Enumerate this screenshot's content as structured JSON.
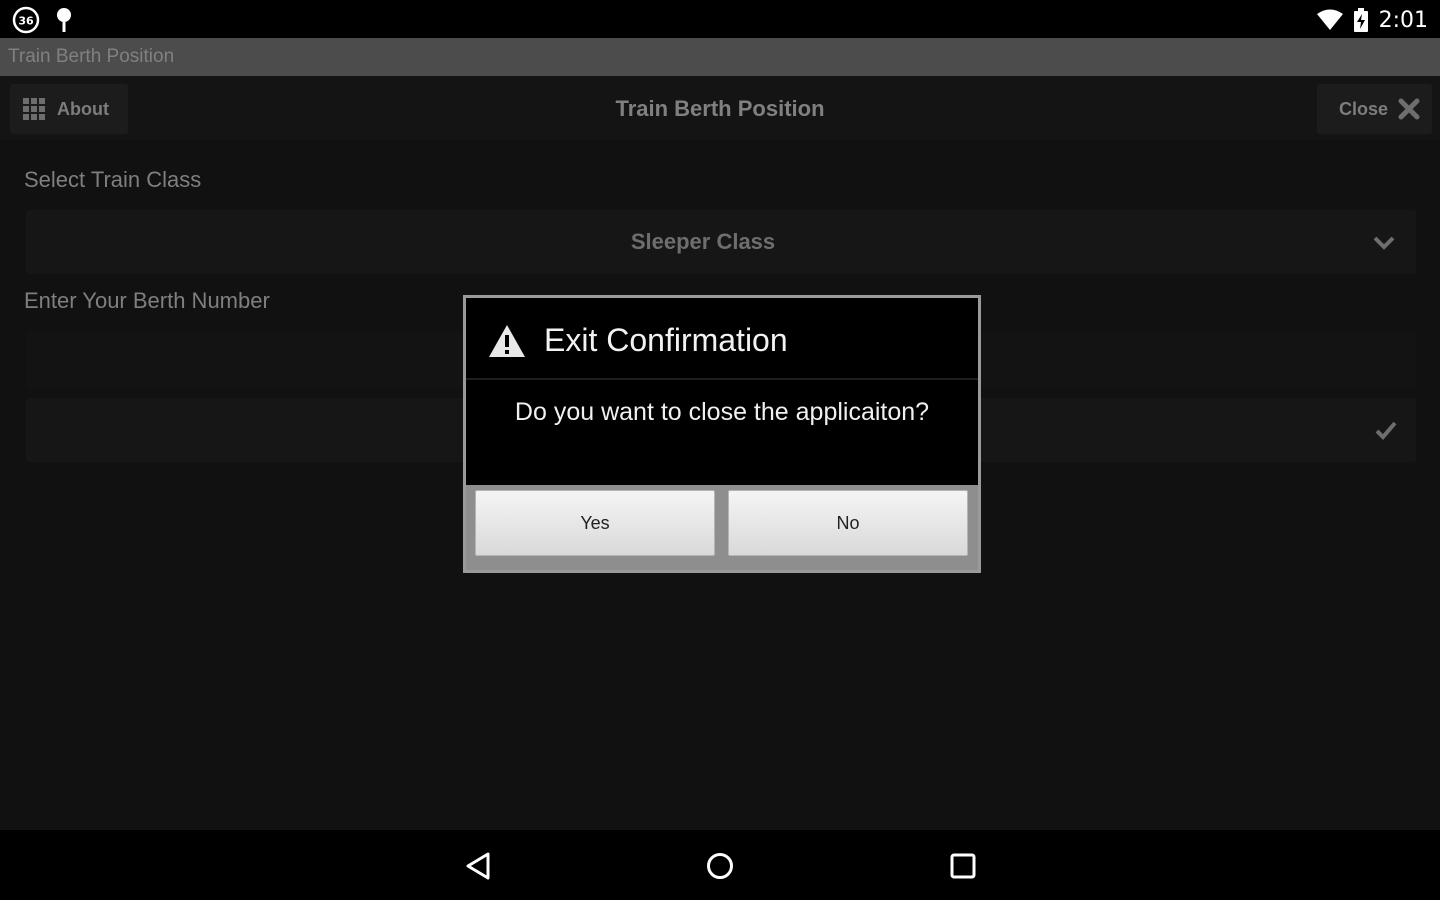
{
  "status_bar": {
    "time": "2:01",
    "icons": [
      "notification-badge-icon",
      "pin-icon",
      "wifi-icon",
      "battery-charging-icon"
    ]
  },
  "window": {
    "title": "Train Berth Position"
  },
  "header": {
    "about_label": "About",
    "title": "Train Berth Position",
    "close_label": "Close"
  },
  "form": {
    "class_label": "Select Train Class",
    "class_selected": "Sleeper Class",
    "berth_label": "Enter Your Berth Number",
    "berth_value": ""
  },
  "dialog": {
    "title": "Exit Confirmation",
    "message": "Do you want to close the applicaiton?",
    "yes_label": "Yes",
    "no_label": "No"
  },
  "nav_bar": {
    "buttons": [
      "back-icon",
      "home-icon",
      "recents-icon"
    ]
  }
}
